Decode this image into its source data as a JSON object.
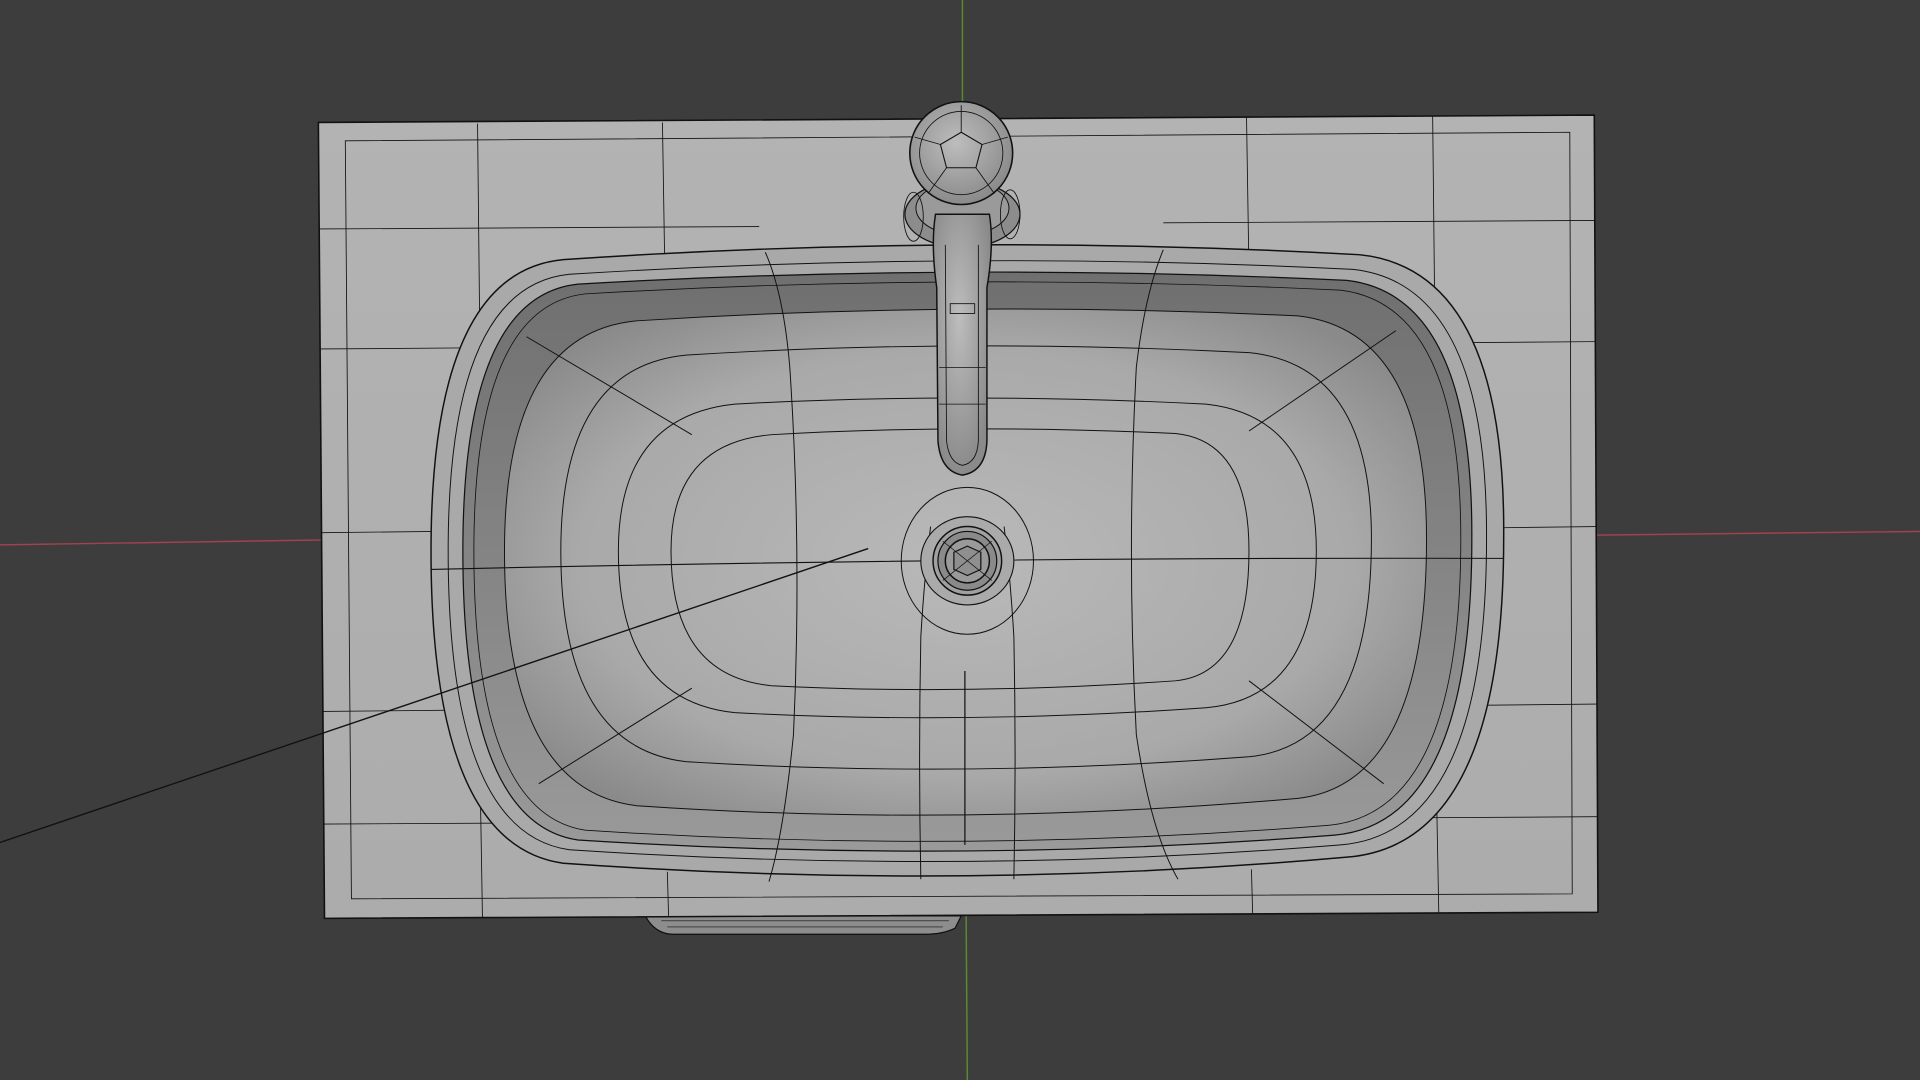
{
  "viewport": {
    "background": "#3d3d3d",
    "x_axis_color": "#a0424f",
    "y_axis_color": "#5d8a30",
    "wire_color": "#111111",
    "surface_light": "#b5b5b5",
    "surface_mid": "#9c9c9c",
    "surface_dark": "#7a7a7a"
  },
  "scene_objects": [
    "countertop-mesh",
    "washbasin-mesh",
    "faucet-mesh",
    "drain-mesh",
    "camera-guide-line"
  ]
}
